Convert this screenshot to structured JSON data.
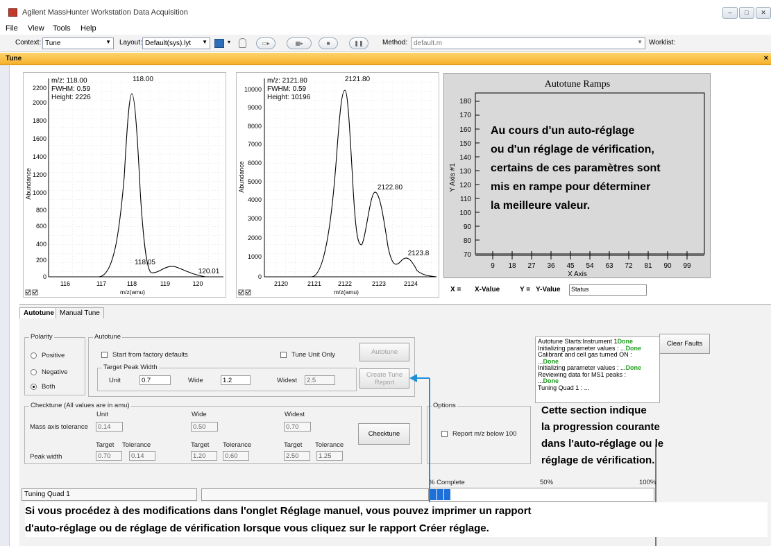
{
  "window": {
    "title": "Agilent MassHunter Workstation Data Acquisition",
    "controls": [
      "–",
      "□",
      "✕"
    ]
  },
  "menu": [
    "File",
    "View",
    "Tools",
    "Help"
  ],
  "toolbar": {
    "context_label": "Context:",
    "context_value": "Tune",
    "layout_label": "Layout:",
    "layout_value": "Default(sys).lyt",
    "method_label": "Method:",
    "method_value": "default.m",
    "worklist_label": "Worklist:"
  },
  "tune_bar": {
    "title": "Tune",
    "close": "×"
  },
  "spectrum1": {
    "mz": "m/z: 118.00",
    "fwhm": "FWHM: 0.59",
    "height": "Height: 2226",
    "ylabel": "Abundance",
    "xlabel": "m/z(amu)",
    "yticks": [
      "2200",
      "2000",
      "1800",
      "1600",
      "1400",
      "1200",
      "1000",
      "800",
      "600",
      "400",
      "200",
      "0"
    ],
    "xticks": [
      "116",
      "117",
      "118",
      "119",
      "120"
    ],
    "peak_labels": [
      "118.00",
      "118.05",
      "120.01"
    ]
  },
  "spectrum2": {
    "mz": "m/z: 2121.80",
    "fwhm": "FWHM: 0.59",
    "height": "Height: 10196",
    "ylabel": "Abundance",
    "xlabel": "m/z(amu)",
    "yticks": [
      "10000",
      "9000",
      "8000",
      "7000",
      "6000",
      "5000",
      "4000",
      "3000",
      "2000",
      "1000",
      "0"
    ],
    "xticks": [
      "2120",
      "2121",
      "2122",
      "2123",
      "2124"
    ],
    "peak_labels": [
      "2121.80",
      "2122.80",
      "2123.8"
    ]
  },
  "ramps": {
    "title": "Autotune Ramps",
    "ylabel": "Y Axis #1",
    "xlabel": "X Axis",
    "yticks": [
      "180",
      "170",
      "160",
      "150",
      "140",
      "130",
      "120",
      "110",
      "100",
      "90",
      "80",
      "70"
    ],
    "xticks": [
      "9",
      "18",
      "27",
      "36",
      "45",
      "54",
      "63",
      "72",
      "81",
      "90",
      "99"
    ],
    "x_eq": "X =",
    "x_value": "X-Value",
    "y_eq": "Y =",
    "y_value": "Y-Value",
    "status": "Status"
  },
  "callout_ramps": [
    "Au cours d'un auto-réglage",
    "ou d'un réglage de vérification,",
    "certains de ces paramètres sont",
    "mis en rampe pour déterminer",
    "la meilleure valeur."
  ],
  "tabs": [
    "Autotune",
    "Manual Tune"
  ],
  "polarity": {
    "title": "Polarity",
    "options": [
      "Positive",
      "Negative",
      "Both"
    ],
    "selected": "Both"
  },
  "autotune": {
    "title": "Autotune",
    "factory_label": "Start from factory defaults",
    "unit_only_label": "Tune Unit Only",
    "autotune_button": "Autotune",
    "report_button_1": "Create Tune",
    "report_button_2": "Report",
    "tpw_title": "Target Peak Width",
    "unit_label": "Unit",
    "unit_value": "0.7",
    "wide_label": "Wide",
    "wide_value": "1.2",
    "widest_label": "Widest",
    "widest_value": "2.5"
  },
  "checktune": {
    "title": "Checktune  (All values are in amu)",
    "unit_header": "Unit",
    "wide_header": "Wide",
    "widest_header": "Widest",
    "mass_label": "Mass axis tolerance",
    "mass_unit": "0.14",
    "mass_wide": "0.50",
    "mass_widest": "0.70",
    "target_label": "Target",
    "tolerance_label": "Tolerance",
    "peak_label": "Peak width",
    "pw_unit_target": "0.70",
    "pw_unit_tol": "0.14",
    "pw_wide_target": "1.20",
    "pw_wide_tol": "0.60",
    "pw_widest_target": "2.50",
    "pw_widest_tol": "1.25",
    "button": "Checktune"
  },
  "options": {
    "title": "Options",
    "report_label": "Report m/z below 100"
  },
  "clear_faults": "Clear Faults",
  "log": {
    "l1": "Autotune Starts:Instrument 1",
    "l2": "Initializing parameter values  : ...",
    "l3": "Calibrant and cell gas turned ON  :",
    "l4": "...",
    "l5": "Initializing parameter values  : ...",
    "l6": "Reviewing data for MS1 peaks  :",
    "l7": "...",
    "l8": "Tuning Quad 1  : ...",
    "done": "Done"
  },
  "callout_progress": [
    "Cette section indique",
    "la progression courante",
    "dans l'auto-réglage ou le",
    "réglage de  vérification."
  ],
  "progress": {
    "label": "% Complete",
    "mid": "50%",
    "max": "100%",
    "fraction": 0.09
  },
  "status_text": "Tuning Quad 1",
  "callout_bottom": [
    "Si vous procédez à des modifications dans l'onglet Réglage manuel, vous pouvez imprimer un rapport",
    "d'auto-réglage ou de réglage de vérification lorsque vous cliquez sur le rapport Créer réglage."
  ],
  "colors": {
    "accent": "#1e8fd8",
    "tune_bar": "#f5b02c",
    "done": "#1c9c1c",
    "progress": "#1e6fd8"
  }
}
